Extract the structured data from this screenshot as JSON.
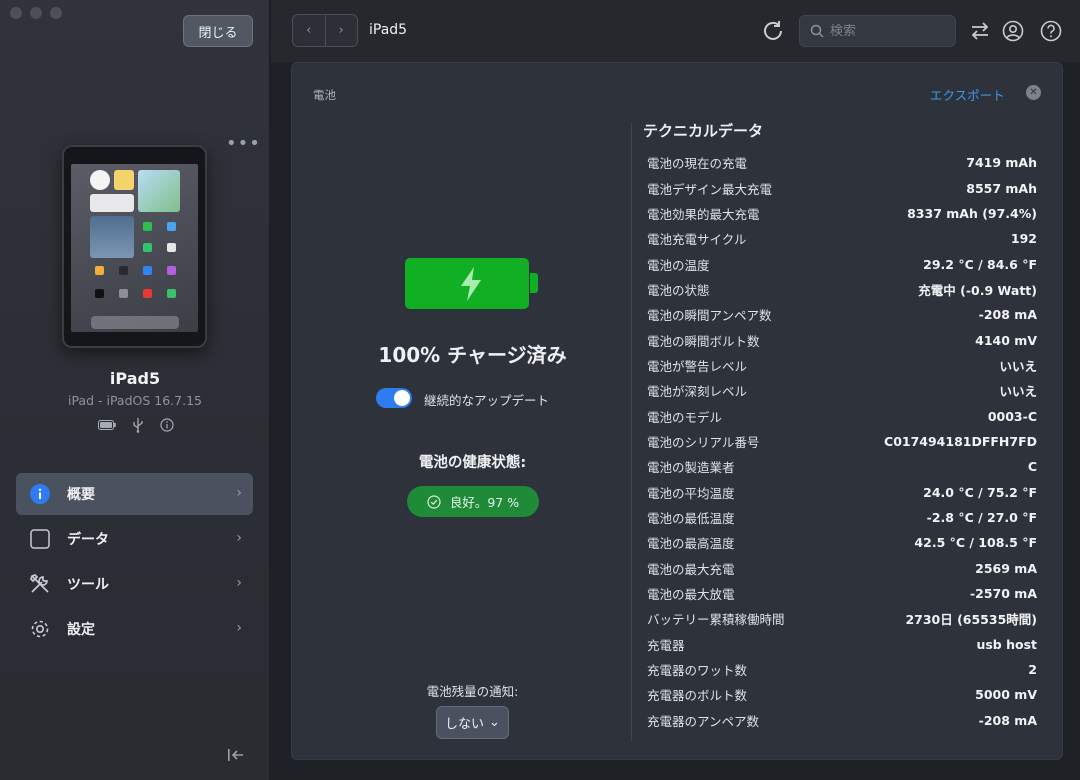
{
  "sidebar": {
    "close_label": "閉じる",
    "device_name": "iPad5",
    "device_sub": "iPad - iPadOS 16.7.15",
    "nav": [
      {
        "label": "概要",
        "icon": "info-icon",
        "active": true
      },
      {
        "label": "データ",
        "icon": "square-icon",
        "active": false
      },
      {
        "label": "ツール",
        "icon": "tools-icon",
        "active": false
      },
      {
        "label": "設定",
        "icon": "gear-icon",
        "active": false
      }
    ]
  },
  "topbar": {
    "title": "iPad5",
    "search_placeholder": "検索"
  },
  "panel": {
    "title": "電池",
    "export_label": "エクスポート",
    "charge_status": "100% チャージ済み",
    "toggle_label": "継続的なアップデート",
    "toggle_on": true,
    "health_label": "電池の健康状態:",
    "health_value": "良好。97 %",
    "notify_label": "電池残量の通知:",
    "notify_value": "しない",
    "tech_title": "テクニカルデータ",
    "tech_rows": [
      {
        "k": "電池の現在の充電",
        "v": "7419 mAh"
      },
      {
        "k": "電池デザイン最大充電",
        "v": "8557 mAh"
      },
      {
        "k": "電池効果的最大充電",
        "v": "8337 mAh (97.4%)"
      },
      {
        "k": "電池充電サイクル",
        "v": "192"
      },
      {
        "k": "電池の温度",
        "v": "29.2 °C / 84.6 °F"
      },
      {
        "k": "電池の状態",
        "v": "充電中 (-0.9 Watt)"
      },
      {
        "k": "電池の瞬間アンペア数",
        "v": "-208 mA"
      },
      {
        "k": "電池の瞬間ボルト数",
        "v": "4140 mV"
      },
      {
        "k": "電池が警告レベル",
        "v": "いいえ"
      },
      {
        "k": "電池が深刻レベル",
        "v": "いいえ"
      },
      {
        "k": "電池のモデル",
        "v": "0003-C"
      },
      {
        "k": "電池のシリアル番号",
        "v": "C017494181DFFH7FD"
      },
      {
        "k": "電池の製造業者",
        "v": "C"
      },
      {
        "k": "電池の平均温度",
        "v": "24.0 °C / 75.2 °F"
      },
      {
        "k": "電池の最低温度",
        "v": "-2.8 °C / 27.0 °F"
      },
      {
        "k": "電池の最高温度",
        "v": "42.5 °C / 108.5 °F"
      },
      {
        "k": "電池の最大充電",
        "v": "2569 mA"
      },
      {
        "k": "電池の最大放電",
        "v": "-2570 mA"
      },
      {
        "k": "バッテリー累積稼働時間",
        "v": "2730日 (65535時間)"
      },
      {
        "k": "充電器",
        "v": "usb host"
      },
      {
        "k": "充電器のワット数",
        "v": "2"
      },
      {
        "k": "充電器のボルト数",
        "v": "5000 mV"
      },
      {
        "k": "充電器のアンペア数",
        "v": "-208 mA"
      }
    ]
  },
  "colors": {
    "accent": "#2f7bf2",
    "battery_green": "#11b024",
    "health_green": "#1f8a37",
    "link_blue": "#3f95f2"
  }
}
